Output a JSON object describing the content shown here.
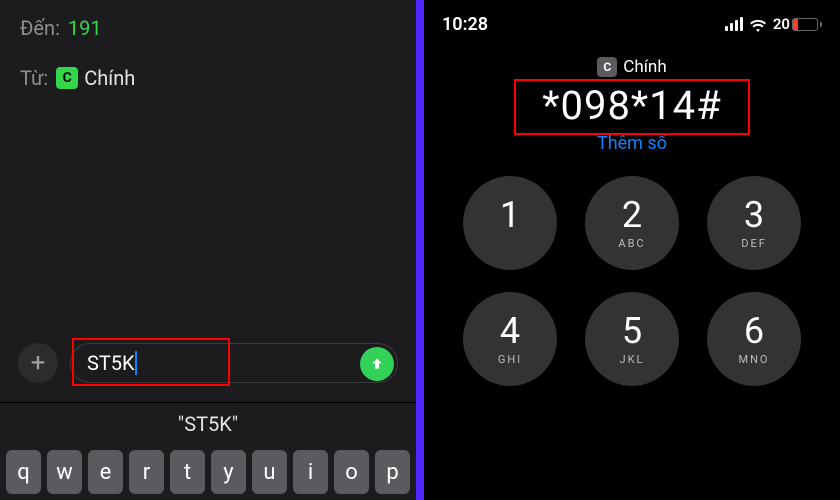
{
  "left": {
    "to_label": "Đến:",
    "to_value": "191",
    "from_label": "Từ:",
    "from_chip": "C",
    "from_value": "Chính",
    "compose_text": "ST5K",
    "suggestion": "\"ST5K\"",
    "keys": [
      "q",
      "w",
      "e",
      "r",
      "t",
      "y",
      "u",
      "i",
      "o",
      "p"
    ]
  },
  "right": {
    "time": "10:28",
    "battery_pct": "20",
    "sim_chip_badge": "C",
    "sim_chip_label": "Chính",
    "dialed": "*098*14#",
    "add_number_label": "Thêm số",
    "keys": [
      {
        "n": "1",
        "s": ""
      },
      {
        "n": "2",
        "s": "ABC"
      },
      {
        "n": "3",
        "s": "DEF"
      },
      {
        "n": "4",
        "s": "GHI"
      },
      {
        "n": "5",
        "s": "JKL"
      },
      {
        "n": "6",
        "s": "MNO"
      }
    ]
  }
}
